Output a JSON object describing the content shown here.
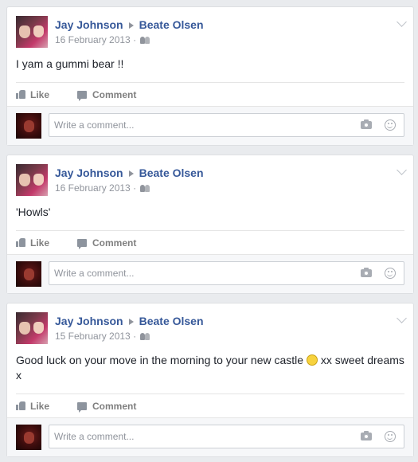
{
  "posts": [
    {
      "author": "Jay Johnson",
      "target": "Beate Olsen",
      "date": "16 February 2013",
      "separator": "·",
      "text": "I yam a gummi bear !!",
      "like_label": "Like",
      "comment_label": "Comment",
      "comment_placeholder": "Write a comment..."
    },
    {
      "author": "Jay Johnson",
      "target": "Beate Olsen",
      "date": "16 February 2013",
      "separator": "·",
      "text": "'Howls'",
      "like_label": "Like",
      "comment_label": "Comment",
      "comment_placeholder": "Write a comment..."
    },
    {
      "author": "Jay Johnson",
      "target": "Beate Olsen",
      "date": "15 February 2013",
      "separator": "·",
      "text_before": "Good luck on your move in the morning to your new castle",
      "text_after": "xx sweet dreams x",
      "like_label": "Like",
      "comment_label": "Comment",
      "comment_placeholder": "Write a comment..."
    }
  ],
  "colors": {
    "link": "#365899",
    "meta": "#90949c",
    "background": "#e9ebee",
    "action": "#7f7f7f"
  },
  "icons": {
    "audience": "friends-icon",
    "menu": "chevron-down-icon",
    "like": "thumbs-up-icon",
    "comment": "speech-bubble-icon",
    "photo": "camera-icon",
    "emoji": "smiley-icon"
  }
}
